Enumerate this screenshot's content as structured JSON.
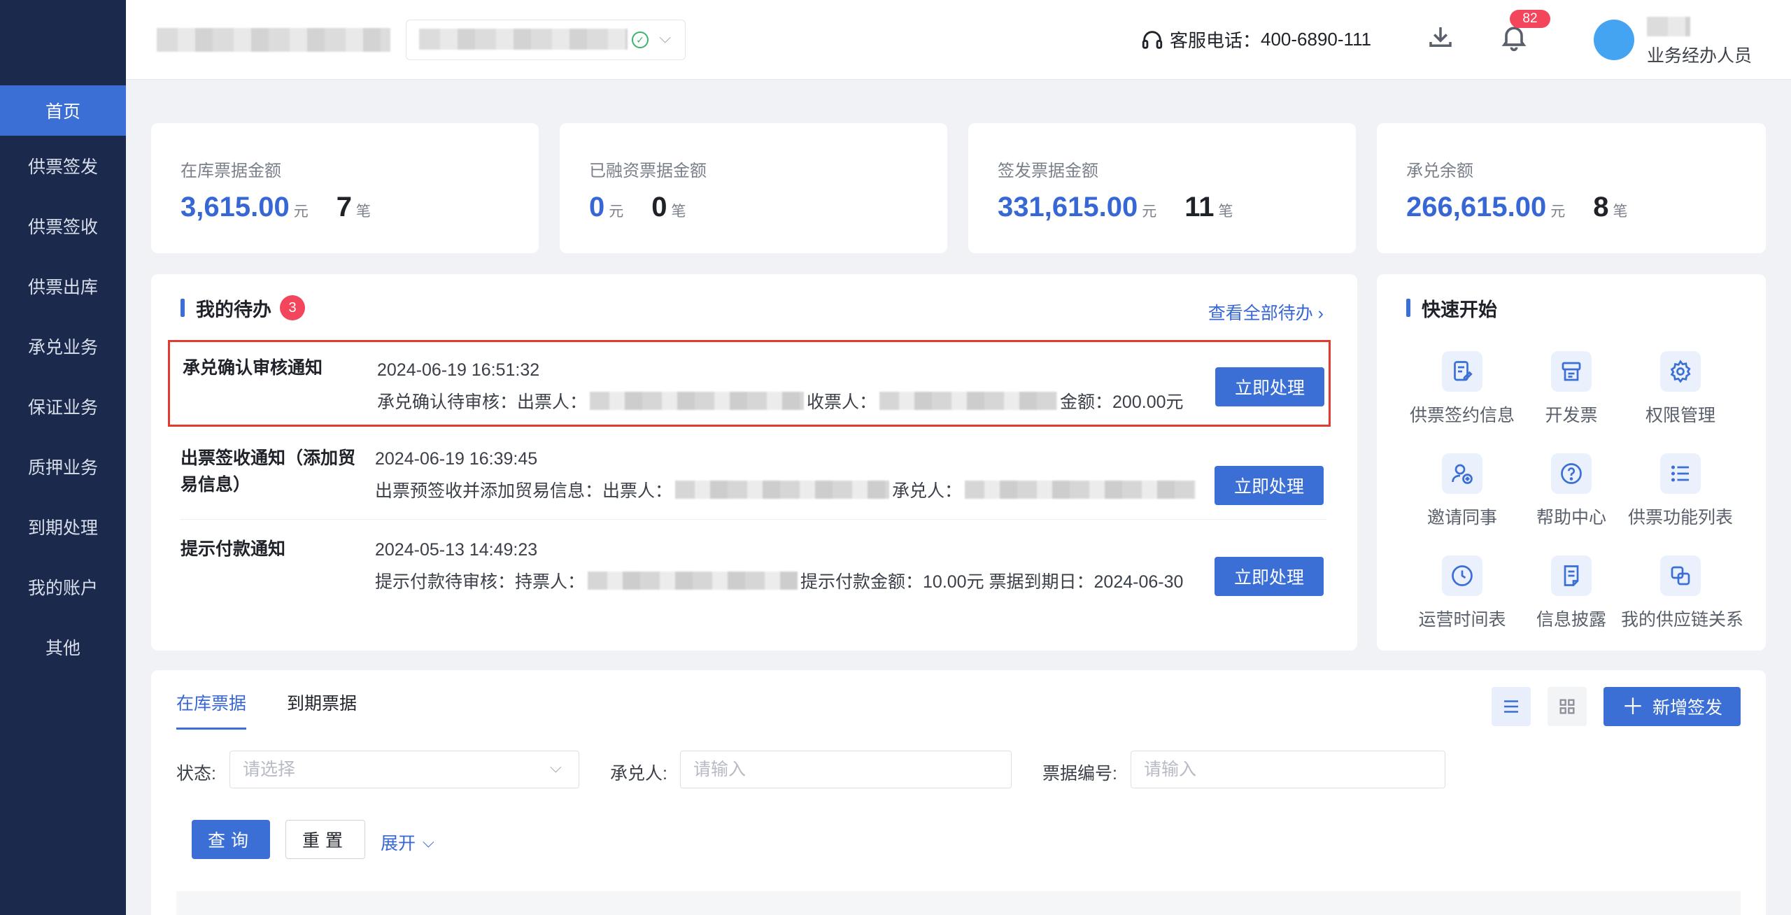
{
  "sidebar": {
    "items": [
      {
        "label": "首页",
        "active": true
      },
      {
        "label": "供票签发"
      },
      {
        "label": "供票签收"
      },
      {
        "label": "供票出库"
      },
      {
        "label": "承兑业务"
      },
      {
        "label": "保证业务"
      },
      {
        "label": "质押业务"
      },
      {
        "label": "到期处理"
      },
      {
        "label": "我的账户"
      },
      {
        "label": "其他"
      }
    ]
  },
  "header": {
    "hotline_label": "客服电话：",
    "hotline_number": "400-6890-111",
    "notification_count": "82",
    "user_role": "业务经办人员",
    "icons": [
      "headset-icon",
      "download-icon",
      "bell-icon",
      "check-circle-icon",
      "chevron-down-icon"
    ]
  },
  "stats": [
    {
      "label": "在库票据金额",
      "amount": "3,615.00",
      "unit": "元",
      "count": "7",
      "count_unit": "笔"
    },
    {
      "label": "已融资票据金额",
      "amount": "0",
      "unit": "元",
      "count": "0",
      "count_unit": "笔"
    },
    {
      "label": "签发票据金额",
      "amount": "331,615.00",
      "unit": "元",
      "count": "11",
      "count_unit": "笔"
    },
    {
      "label": "承兑余额",
      "amount": "266,615.00",
      "unit": "元",
      "count": "8",
      "count_unit": "笔"
    }
  ],
  "todo": {
    "title": "我的待办",
    "badge": "3",
    "view_all": "查看全部待办",
    "items": [
      {
        "title": "承兑确认审核通知",
        "time": "2024-06-19 16:51:32",
        "desc_prefix": "承兑确认待审核：出票人：",
        "desc_mid": "收票人：",
        "desc_suffix": "金额：200.00元",
        "action": "立即处理"
      },
      {
        "title": "出票签收通知（添加贸易信息）",
        "time": "2024-06-19 16:39:45",
        "desc_prefix": "出票预签收并添加贸易信息：出票人：",
        "desc_mid": "承兑人：",
        "desc_suffix": "",
        "action": "立即处理"
      },
      {
        "title": "提示付款通知",
        "time": "2024-05-13 14:49:23",
        "desc_prefix": "提示付款待审核：持票人：",
        "desc_mid": "",
        "desc_suffix": "提示付款金额：10.00元 票据到期日：2024-06-30",
        "action": "立即处理"
      }
    ]
  },
  "quick_start": {
    "title": "快速开始",
    "items": [
      {
        "label": "供票签约信息",
        "icon": "contract-edit-icon"
      },
      {
        "label": "开发票",
        "icon": "invoice-icon"
      },
      {
        "label": "权限管理",
        "icon": "gear-icon"
      },
      {
        "label": "邀请同事",
        "icon": "user-add-icon"
      },
      {
        "label": "帮助中心",
        "icon": "help-icon"
      },
      {
        "label": "供票功能列表",
        "icon": "list-icon"
      },
      {
        "label": "运营时间表",
        "icon": "clock-icon"
      },
      {
        "label": "信息披露",
        "icon": "document-icon"
      },
      {
        "label": "我的供应链关系",
        "icon": "link-copy-icon"
      }
    ]
  },
  "bills": {
    "tabs": [
      "在库票据",
      "到期票据"
    ],
    "active_tab": "在库票据",
    "add_button": "新增签发",
    "filters": {
      "status_label": "状态:",
      "status_placeholder": "请选择",
      "acceptor_label": "承兑人:",
      "acceptor_placeholder": "请输入",
      "bill_no_label": "票据编号:",
      "bill_no_placeholder": "请输入"
    },
    "query_button": "查询",
    "reset_button": "重置",
    "expand_label": "展开"
  },
  "colors": {
    "primary": "#3b6fd6",
    "sidebar_bg": "#1b2a4c",
    "badge_red": "#f3455b",
    "highlight_border": "#e33a2f"
  }
}
